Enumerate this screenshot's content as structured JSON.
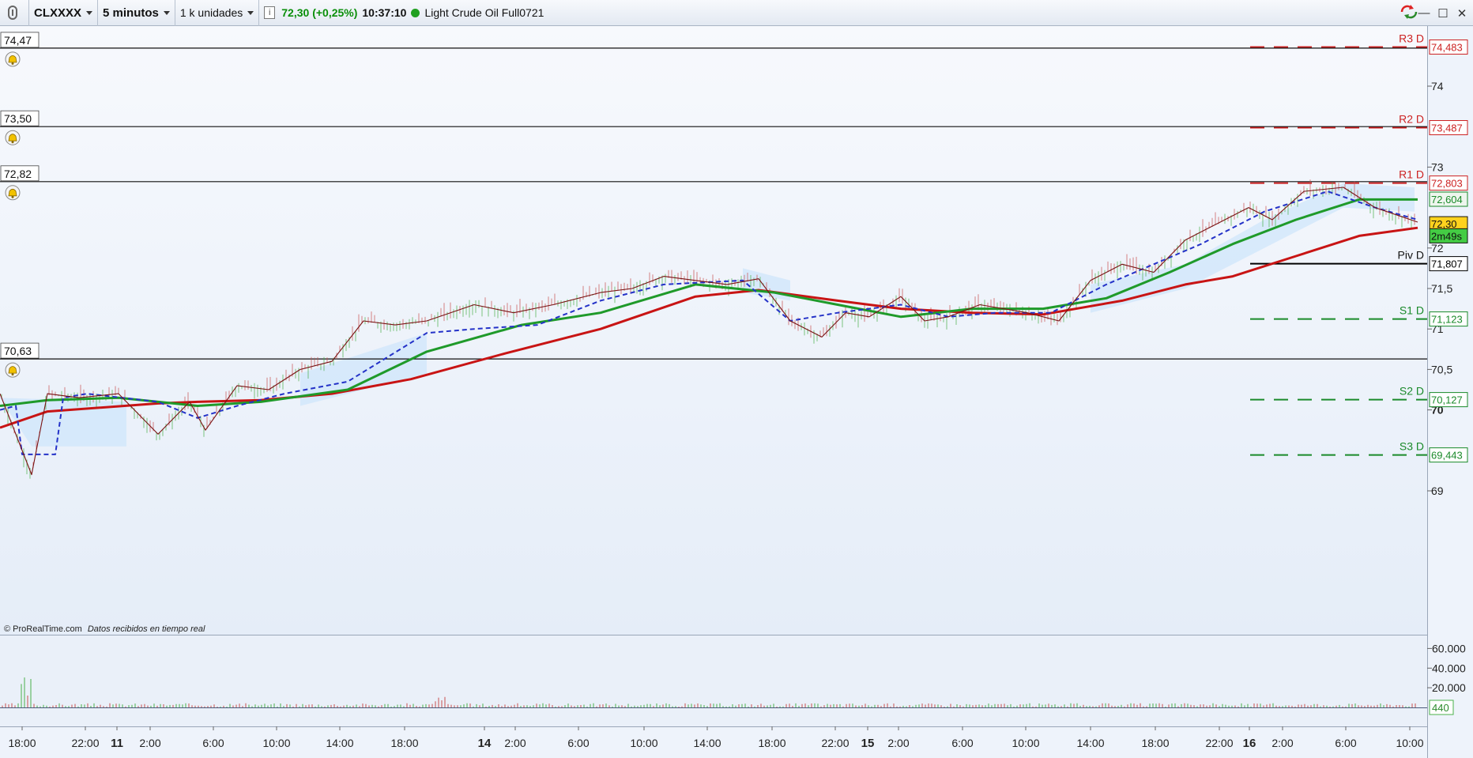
{
  "toolbar": {
    "symbol": "CLXXXX",
    "timeframe": "5 minutos",
    "units": "1 k unidades",
    "price": "72,30 (+0,25%)",
    "time": "10:37:10",
    "instrument": "Light Crude Oil Full0721",
    "status_color": "#20a020",
    "window_buttons": [
      "—",
      "☐",
      "✕"
    ]
  },
  "footer": {
    "copyright": "© ProRealTime.com",
    "realtime": "Datos recibidos en tiempo real"
  },
  "chart_data": [
    {
      "type": "line",
      "title": "",
      "x": [
        "18:00",
        "22:00",
        "11",
        "2:00",
        "6:00",
        "10:00",
        "14:00",
        "18:00",
        "14",
        "2:00",
        "6:00",
        "10:00",
        "14:00",
        "18:00",
        "22:00",
        "15",
        "2:00",
        "6:00",
        "10:00",
        "14:00",
        "18:00",
        "22:00",
        "16",
        "2:00",
        "6:00",
        "10:00"
      ],
      "x_bold": [
        "11",
        "14",
        "15",
        "16"
      ],
      "ylim": [
        68.5,
        75.0
      ],
      "y_ticks": [
        "74",
        "73",
        "72",
        "71,5",
        "71",
        "70,5",
        "70",
        "69"
      ],
      "y_tick_values": [
        74,
        73,
        72,
        71.5,
        71,
        70.5,
        70,
        69
      ],
      "alert_lines": [
        {
          "label": "74,47",
          "value": 74.47
        },
        {
          "label": "73,50",
          "value": 73.5
        },
        {
          "label": "72,82",
          "value": 72.82
        },
        {
          "label": "70,63",
          "value": 70.63
        }
      ],
      "pivot_levels": [
        {
          "name": "R3 D",
          "value": 74.483,
          "label": "74,483",
          "color": "#cc2222",
          "dash": true
        },
        {
          "name": "R2 D",
          "value": 73.487,
          "label": "73,487",
          "color": "#cc2222",
          "dash": true
        },
        {
          "name": "R1 D",
          "value": 72.803,
          "label": "72,803",
          "color": "#cc2222",
          "dash": true
        },
        {
          "name": "Piv D",
          "value": 71.807,
          "label": "71,807",
          "color": "#000000",
          "dash": false
        },
        {
          "name": "S1 D",
          "value": 71.123,
          "label": "71,123",
          "color": "#1a8a2a",
          "dash": true
        },
        {
          "name": "S2 D",
          "value": 70.127,
          "label": "70,127",
          "color": "#1a8a2a",
          "dash": true
        },
        {
          "name": "S3 D",
          "value": 69.443,
          "label": "69,443",
          "color": "#1a8a2a",
          "dash": true
        }
      ],
      "price_tags": [
        {
          "label": "72,604",
          "value": 72.604,
          "color": "#1a8a2a",
          "bg": "#eef6ee"
        },
        {
          "label": "72,30",
          "value": 72.3,
          "color": "#111111",
          "bg": "#ffd21e"
        },
        {
          "label": "2m49s",
          "value": 72.15,
          "color": "#111111",
          "bg": "#44cc44"
        }
      ],
      "series": [
        {
          "color": "#c81414",
          "values": [
            [
              0,
              69.78
            ],
            [
              60,
              69.98
            ],
            [
              200,
              70.08
            ],
            [
              250,
              70.1
            ],
            [
              330,
              70.12
            ],
            [
              420,
              70.2
            ],
            [
              520,
              70.38
            ],
            [
              640,
              70.7
            ],
            [
              760,
              71.0
            ],
            [
              880,
              71.4
            ],
            [
              960,
              71.48
            ],
            [
              1060,
              71.35
            ],
            [
              1140,
              71.25
            ],
            [
              1230,
              71.2
            ],
            [
              1320,
              71.18
            ],
            [
              1420,
              71.35
            ],
            [
              1500,
              71.55
            ],
            [
              1560,
              71.65
            ],
            [
              1640,
              71.9
            ],
            [
              1720,
              72.15
            ],
            [
              1794,
              72.25
            ]
          ]
        },
        {
          "color": "#1f9a2a",
          "values": [
            [
              0,
              70.05
            ],
            [
              60,
              70.12
            ],
            [
              150,
              70.15
            ],
            [
              250,
              70.05
            ],
            [
              330,
              70.1
            ],
            [
              440,
              70.25
            ],
            [
              540,
              70.72
            ],
            [
              660,
              71.05
            ],
            [
              760,
              71.2
            ],
            [
              880,
              71.55
            ],
            [
              980,
              71.45
            ],
            [
              1060,
              71.3
            ],
            [
              1140,
              71.15
            ],
            [
              1230,
              71.25
            ],
            [
              1320,
              71.25
            ],
            [
              1400,
              71.38
            ],
            [
              1480,
              71.7
            ],
            [
              1560,
              72.05
            ],
            [
              1640,
              72.35
            ],
            [
              1720,
              72.6
            ],
            [
              1794,
              72.6
            ]
          ]
        },
        {
          "color": "#2432c8",
          "dashed": true,
          "values": [
            [
              0,
              70.0
            ],
            [
              20,
              70.05
            ],
            [
              28,
              69.45
            ],
            [
              70,
              69.45
            ],
            [
              80,
              70.15
            ],
            [
              110,
              70.2
            ],
            [
              200,
              70.1
            ],
            [
              250,
              69.9
            ],
            [
              300,
              70.05
            ],
            [
              360,
              70.2
            ],
            [
              440,
              70.35
            ],
            [
              540,
              70.95
            ],
            [
              600,
              71.0
            ],
            [
              680,
              71.05
            ],
            [
              760,
              71.35
            ],
            [
              840,
              71.55
            ],
            [
              940,
              71.6
            ],
            [
              1000,
              71.1
            ],
            [
              1060,
              71.2
            ],
            [
              1140,
              71.3
            ],
            [
              1200,
              71.15
            ],
            [
              1260,
              71.2
            ],
            [
              1330,
              71.2
            ],
            [
              1400,
              71.55
            ],
            [
              1460,
              71.8
            ],
            [
              1520,
              72.05
            ],
            [
              1600,
              72.45
            ],
            [
              1680,
              72.7
            ],
            [
              1740,
              72.5
            ],
            [
              1794,
              72.35
            ]
          ]
        },
        {
          "color": "#7a1212",
          "values": [
            [
              0,
              70.2
            ],
            [
              40,
              69.2
            ],
            [
              60,
              70.2
            ],
            [
              100,
              70.15
            ],
            [
              150,
              70.2
            ],
            [
              200,
              69.7
            ],
            [
              240,
              70.1
            ],
            [
              260,
              69.75
            ],
            [
              300,
              70.3
            ],
            [
              340,
              70.25
            ],
            [
              380,
              70.5
            ],
            [
              420,
              70.6
            ],
            [
              460,
              71.1
            ],
            [
              500,
              71.05
            ],
            [
              540,
              71.1
            ],
            [
              600,
              71.3
            ],
            [
              650,
              71.2
            ],
            [
              700,
              71.3
            ],
            [
              760,
              71.45
            ],
            [
              800,
              71.5
            ],
            [
              840,
              71.65
            ],
            [
              880,
              71.6
            ],
            [
              920,
              71.55
            ],
            [
              960,
              71.62
            ],
            [
              1000,
              71.1
            ],
            [
              1040,
              70.9
            ],
            [
              1070,
              71.2
            ],
            [
              1100,
              71.15
            ],
            [
              1140,
              71.4
            ],
            [
              1170,
              71.1
            ],
            [
              1200,
              71.15
            ],
            [
              1240,
              71.3
            ],
            [
              1300,
              71.2
            ],
            [
              1340,
              71.1
            ],
            [
              1380,
              71.6
            ],
            [
              1420,
              71.8
            ],
            [
              1460,
              71.7
            ],
            [
              1500,
              72.1
            ],
            [
              1540,
              72.3
            ],
            [
              1580,
              72.5
            ],
            [
              1610,
              72.35
            ],
            [
              1650,
              72.7
            ],
            [
              1700,
              72.75
            ],
            [
              1740,
              72.5
            ],
            [
              1794,
              72.32
            ]
          ]
        }
      ]
    },
    {
      "type": "bar",
      "title": "",
      "ylim": [
        0,
        70000
      ],
      "y_ticks": [
        "60.000",
        "40.000",
        "20.000"
      ],
      "y_tick_values": [
        60000,
        40000,
        20000
      ],
      "last_value": "440",
      "values": []
    }
  ]
}
